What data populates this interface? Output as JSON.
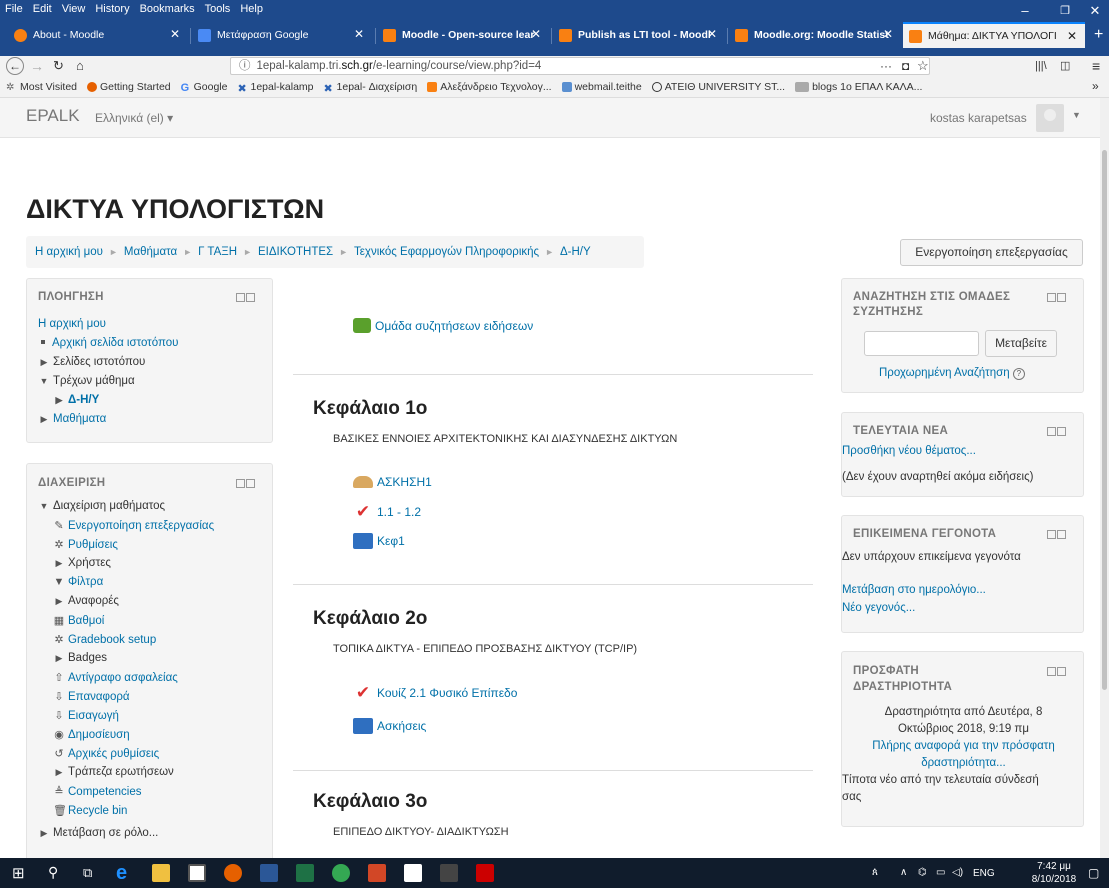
{
  "browser": {
    "menu": [
      "File",
      "Edit",
      "View",
      "History",
      "Bookmarks",
      "Tools",
      "Help"
    ],
    "tabs": [
      {
        "label": "About - Moodle",
        "color": "#f98012"
      },
      {
        "label": "Μετάφραση Google",
        "color": "#4a8af4"
      },
      {
        "label": "Moodle - Open-source lear",
        "color": "#f98012"
      },
      {
        "label": "Publish as LTI tool - Moodl",
        "color": "#f98012"
      },
      {
        "label": "Moodle.org: Moodle Statist",
        "color": "#f98012"
      },
      {
        "label": "Μάθημα: ΔΙΚΤΥΑ ΥΠΟΛΟΓΙ",
        "color": "#f98012"
      }
    ],
    "url_host": "1epal-kalamp.tri.",
    "url_domain": "sch.gr",
    "url_path": "/e-learning/course/view.php?id=4",
    "bookmarks": [
      "Most Visited",
      "Getting Started",
      "Google",
      "1epal-kalamp",
      "1epal- Διαχείριση",
      "Αλεξάνδρειο Τεχνολογ...",
      "webmail.teithe",
      "ΑΤΕΙΘ UNIVERSITY ST...",
      "blogs 1ο ΕΠΑΛ ΚΑΛΑ..."
    ]
  },
  "moodle": {
    "brand": "EPALK",
    "lang": "Ελληνικά (el) ▾",
    "user": "kostas karapetsas"
  },
  "course_title": "ΔΙΚΤΥΑ ΥΠΟΛΟΓΙΣΤΩΝ",
  "breadcrumb": [
    "Η αρχική μου",
    "Μαθήματα",
    "Γ ΤΑΞΗ",
    "ΕΙΔΙΚΟΤΗΤΕΣ",
    "Τεχνικός Εφαρμογών Πληροφορικής",
    "Δ-Η/Υ"
  ],
  "edit_button": "Ενεργοποίηση επεξεργασίας",
  "nav_block": {
    "title": "ΠΛΟΗΓΗΣΗ",
    "home": "Η αρχική μου",
    "site_home": "Αρχική σελίδα ιστοτόπου",
    "site_pages": "Σελίδες ιστοτόπου",
    "current_course": "Τρέχων μάθημα",
    "course": "Δ-Η/Υ",
    "courses": "Μαθήματα"
  },
  "admin_block": {
    "title": "ΔΙΑΧΕΙΡΙΣΗ",
    "course_admin": "Διαχείριση μαθήματος",
    "items": [
      "Ενεργοποίηση επεξεργασίας",
      "Ρυθμίσεις",
      "Χρήστες",
      "Φίλτρα",
      "Αναφορές",
      "Βαθμοί",
      "Gradebook setup",
      "Badges",
      "Αντίγραφο ασφαλείας",
      "Επαναφορά",
      "Εισαγωγή",
      "Δημοσίευση",
      "Αρχικές ρυθμίσεις",
      "Τράπεζα ερωτήσεων",
      "Competencies",
      "Recycle bin"
    ],
    "switch_role": "Μετάβαση σε ρόλο..."
  },
  "forum_link": "Ομάδα συζητήσεων ειδήσεων",
  "sections": [
    {
      "title": "Κεφάλαιο 1ο",
      "summary": "ΒΑΣΙΚΕΣ ΕΝΝΟΙΕΣ ΑΡΧΙΤΕΚΤΟΝΙΚΗΣ ΚΑΙ ΔΙΑΣΥΝΔΕΣΗΣ ΔΙΚΤΥΩΝ",
      "activities": [
        "ΑΣΚΗΣΗ1",
        "1.1 - 1.2",
        "Κεφ1"
      ]
    },
    {
      "title": "Κεφάλαιο 2ο",
      "summary": "ΤΟΠΙΚΑ ΔΙΚΤΥΑ - ΕΠΙΠΕΔΟ ΠΡΟΣΒΑΣΗΣ ΔΙΚΤΥΟΥ (TCP/IP)",
      "activities": [
        "Κουίζ 2.1 Φυσικό Επίπεδο",
        "Ασκήσεις"
      ]
    },
    {
      "title": "Κεφάλαιο 3ο",
      "summary": "ΕΠΙΠΕΔΟ ΔΙΚΤΥΟΥ- ΔΙΑΔΙΚΤΥΩΣΗ",
      "activities": []
    }
  ],
  "search_block": {
    "title1": "ΑΝΑΖΗΤΗΣΗ ΣΤΙΣ ΟΜΑΔΕΣ",
    "title2": "ΣΥΖΗΤΗΣΗΣ",
    "button": "Μεταβείτε",
    "advanced": "Προχωρημένη Αναζήτηση"
  },
  "news_block": {
    "title": "ΤΕΛΕΥΤΑΙΑ ΝΕΑ",
    "add": "Προσθήκη νέου θέματος...",
    "empty": "(Δεν έχουν αναρτηθεί ακόμα ειδήσεις)"
  },
  "events_block": {
    "title": "ΕΠΙΚΕΙΜΕΝΑ ΓΕΓΟΝΟΤΑ",
    "empty": "Δεν υπάρχουν επικείμενα γεγονότα",
    "calendar": "Μετάβαση στο ημερολόγιο...",
    "new_event": "Νέο γεγονός..."
  },
  "recent_block": {
    "title1": "ΠΡΟΣΦΑΤΗ",
    "title2": "ΔΡΑΣΤΗΡΙΟΤΗΤΑ",
    "since1": "Δραστηριότητα από Δευτέρα, 8",
    "since2": "Οκτώβριος 2018, 9:19 πμ",
    "report1": "Πλήρης αναφορά για την πρόσφατη",
    "report2": "δραστηριότητα...",
    "nothing1": "Τίποτα νέο από την τελευταία σύνδεσή",
    "nothing2": "σας"
  },
  "taskbar": {
    "lang": "ENG",
    "time": "7:42 μμ",
    "date": "8/10/2018"
  }
}
